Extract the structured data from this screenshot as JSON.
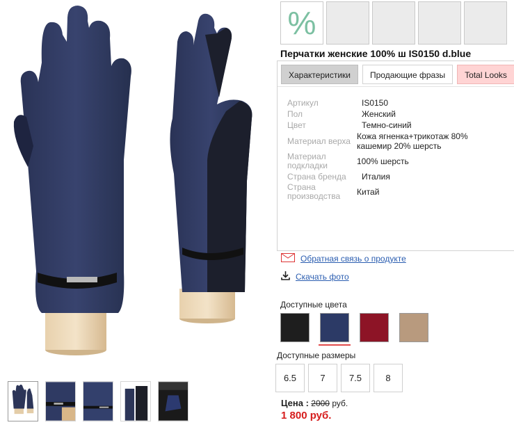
{
  "product": {
    "title": "Перчатки женские 100% ш IS0150 d.blue",
    "discount_symbol": "%"
  },
  "tabs": [
    {
      "label": "Характеристики"
    },
    {
      "label": "Продающие фразы"
    },
    {
      "label": "Total Looks"
    }
  ],
  "specs": [
    {
      "label": "Артикул",
      "value": "IS0150"
    },
    {
      "label": "Пол",
      "value": "Женский"
    },
    {
      "label": "Цвет",
      "value": "Темно-синий"
    },
    {
      "label": "Материал верха",
      "value": "Кожа ягненка+трикотаж 80% кашемир 20% шерсть"
    },
    {
      "label": "Материал подкладки",
      "value": "100% шерсть"
    },
    {
      "label": "Страна бренда",
      "value": "Италия"
    },
    {
      "label": "Страна производства",
      "value": "Китай"
    }
  ],
  "links": {
    "feedback": "Обратная связь о продукте",
    "download": "Скачать фото",
    "feedback_icon": "envelope-icon",
    "download_icon": "download-icon"
  },
  "colors": {
    "label": "Доступные цвета",
    "items": [
      {
        "name": "black",
        "hex": "#1e1e1e"
      },
      {
        "name": "dark-blue",
        "hex": "#2c3a66",
        "selected": true
      },
      {
        "name": "bordeaux",
        "hex": "#8d1426"
      },
      {
        "name": "beige",
        "hex": "#b89a7e"
      }
    ],
    "accent": "#e24b4b"
  },
  "sizes": {
    "label": "Доступные размеры",
    "items": [
      "6.5",
      "7",
      "7.5",
      "8"
    ]
  },
  "price": {
    "label": "Цена :",
    "old": "2000",
    "old_currency": "руб.",
    "new": "1 800 руб."
  }
}
